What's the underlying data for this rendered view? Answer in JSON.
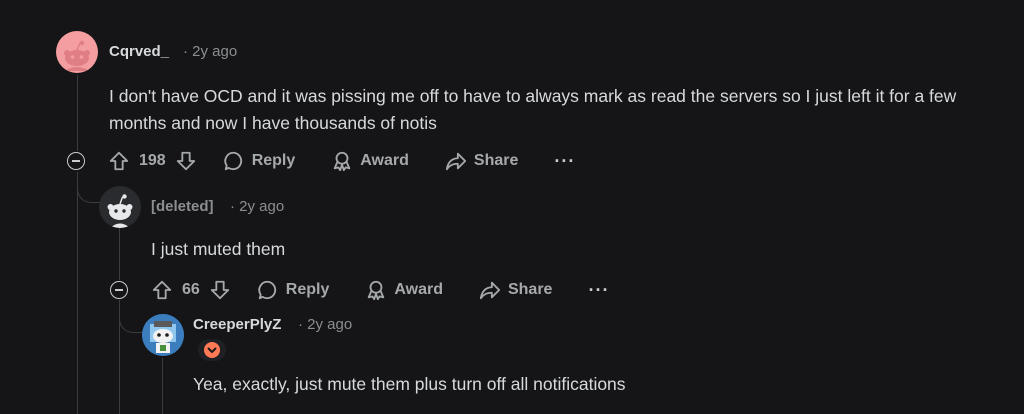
{
  "comments": [
    {
      "username": "Cqrved_",
      "time": "· 2y ago",
      "text": "I don't have OCD and it was pissing me off to have to always mark as read the servers so I just left it for a few months and now I have thousands of notis",
      "votes": "198",
      "reply_label": "Reply",
      "award_label": "Award",
      "share_label": "Share",
      "more_label": "···"
    },
    {
      "username": "[deleted]",
      "time": "· 2y ago",
      "text": "I just muted them",
      "votes": "66",
      "reply_label": "Reply",
      "award_label": "Award",
      "share_label": "Share",
      "more_label": "···"
    },
    {
      "username": "CreeperPlyZ",
      "time": "· 2y ago",
      "text": "Yea, exactly, just mute them plus turn off all notifications"
    }
  ],
  "colors": {
    "background": "#151517",
    "text": "#d7dadc",
    "muted": "#8b8e90",
    "flair": "#ff7a55"
  }
}
